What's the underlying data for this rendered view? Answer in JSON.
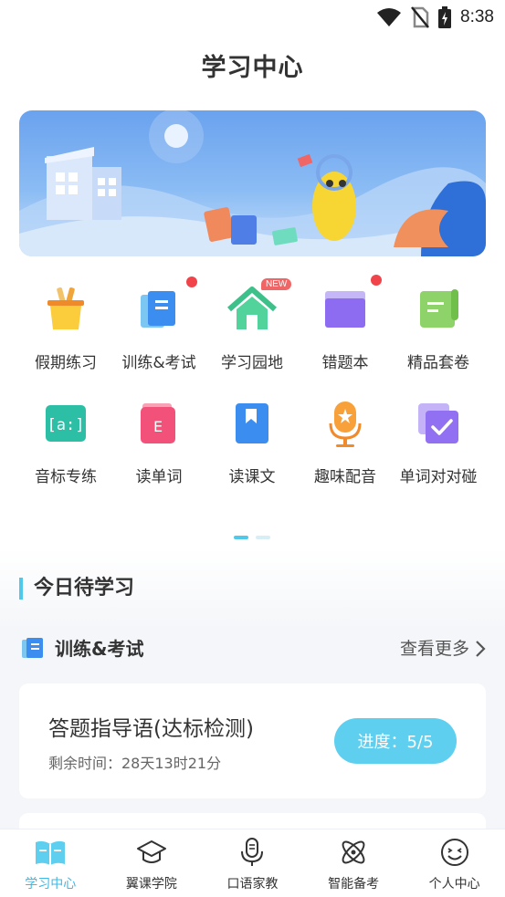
{
  "status_bar": {
    "time": "8:38"
  },
  "page": {
    "title": "学习中心"
  },
  "features": [
    {
      "label": "假期练习",
      "icon": "basket-icon",
      "badge": ""
    },
    {
      "label": "训练&考试",
      "icon": "notebook-icon",
      "badge": "dot"
    },
    {
      "label": "学习园地",
      "icon": "house-icon",
      "badge": "NEW"
    },
    {
      "label": "错题本",
      "icon": "folder-icon",
      "badge": "dot"
    },
    {
      "label": "精品套卷",
      "icon": "paper-roll-icon",
      "badge": ""
    },
    {
      "label": "音标专练",
      "icon": "phonetic-icon",
      "badge": ""
    },
    {
      "label": "读单词",
      "icon": "word-card-icon",
      "badge": ""
    },
    {
      "label": "读课文",
      "icon": "bookmark-book-icon",
      "badge": ""
    },
    {
      "label": "趣味配音",
      "icon": "microphone-icon",
      "badge": ""
    },
    {
      "label": "单词对对碰",
      "icon": "checkbox-stack-icon",
      "badge": ""
    }
  ],
  "new_badge": "NEW",
  "pager": {
    "pages": 2,
    "current": 1
  },
  "today": {
    "title": "今日待学习"
  },
  "training": {
    "title": "训练&考试",
    "see_more": "查看更多"
  },
  "task_card": {
    "title": "答题指导语(达标检测)",
    "remaining": "剩余时间：28天13时21分",
    "progress": "进度：5/5"
  },
  "tabs": [
    {
      "label": "学习中心",
      "icon": "open-book-icon",
      "active": true
    },
    {
      "label": "翼课学院",
      "icon": "graduation-cap-icon",
      "active": false
    },
    {
      "label": "口语家教",
      "icon": "microphone-outline-icon",
      "active": false
    },
    {
      "label": "智能备考",
      "icon": "atom-icon",
      "active": false
    },
    {
      "label": "个人中心",
      "icon": "smiley-icon",
      "active": false
    }
  ],
  "colors": {
    "accent": "#4fc8ea",
    "badge_red": "#f0444a",
    "progress_btn": "#5fcff0"
  }
}
